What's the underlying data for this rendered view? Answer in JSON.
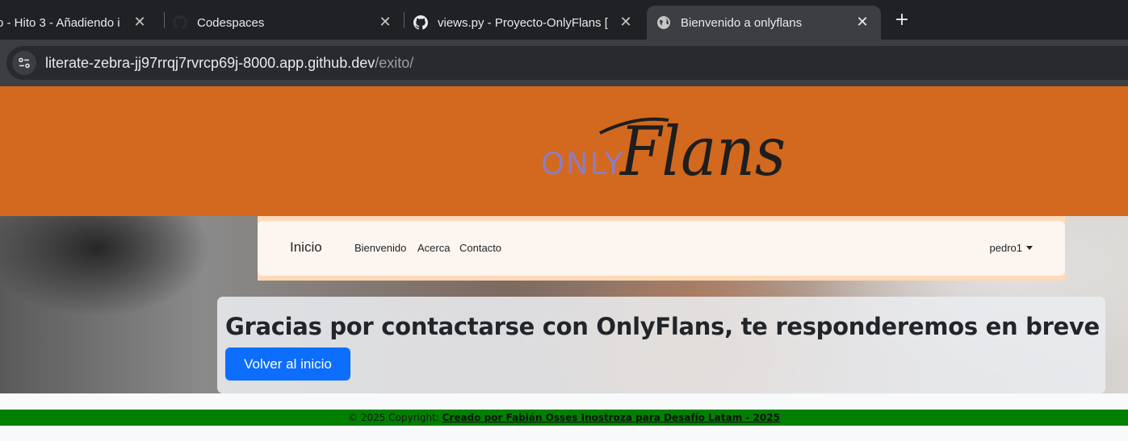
{
  "browser": {
    "tabs": [
      {
        "title": "o - Hito 3 - Añadiendo i",
        "icon": "none"
      },
      {
        "title": "Codespaces",
        "icon": "github-icon"
      },
      {
        "title": "views.py - Proyecto-OnlyFlans [",
        "icon": "github-icon"
      },
      {
        "title": "Bienvenido a onlyflans",
        "icon": "globe-icon"
      }
    ],
    "close_glyph": "✕",
    "new_tab_glyph": "+",
    "url_host": "literate-zebra-jj97rrqj7rvrcp69j-8000.app.github.dev",
    "url_path": "/exito/"
  },
  "header": {
    "logo_only": "ONLY",
    "logo_flans": "Flans",
    "background_color": "#d2691e"
  },
  "navbar": {
    "brand": "Inicio",
    "links": [
      "Bienvenido",
      "Acerca",
      "Contacto"
    ],
    "user": "pedro1"
  },
  "main": {
    "heading": "Gracias por contactarse con OnlyFlans, te responderemos en breve",
    "button_label": "Volver al inicio",
    "button_color": "#0d6efd"
  },
  "footer": {
    "prefix": "© 2025 Copyright: ",
    "link_text": "Creado por Fabián Osses Inostroza para Desafío Latam - 2025",
    "background_color": "#008000"
  }
}
